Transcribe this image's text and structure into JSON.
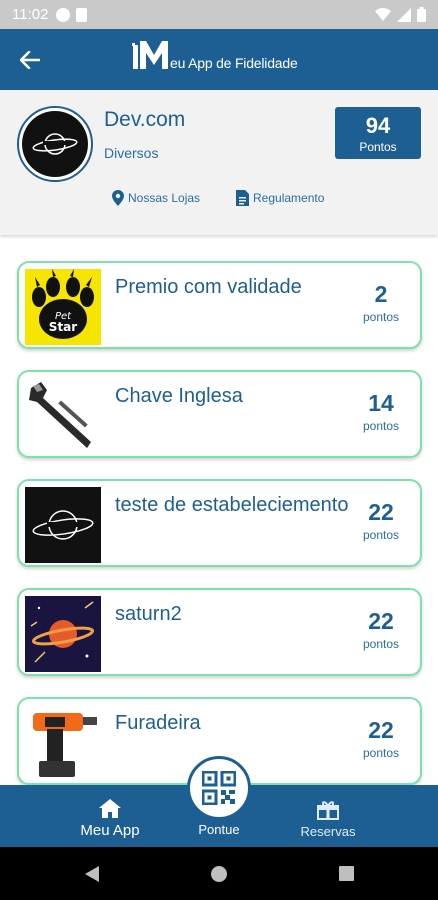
{
  "status_bar": {
    "time": "11:02"
  },
  "app_bar": {
    "logo_text": "eu App de Fidelidade"
  },
  "store": {
    "name": "Dev.com",
    "category": "Diversos",
    "points_value": "94",
    "points_label": "Pontos",
    "links": {
      "stores": "Nossas Lojas",
      "rules": "Regulamento"
    }
  },
  "rewards": [
    {
      "title": "Premio com validade",
      "points": "2",
      "unit": "pontos",
      "image": "pet-star-paw-logo"
    },
    {
      "title": "Chave Inglesa",
      "points": "14",
      "unit": "pontos",
      "image": "wrench"
    },
    {
      "title": "teste de estabeleciemento",
      "points": "22",
      "unit": "pontos",
      "image": "saturn-logo"
    },
    {
      "title": "saturn2",
      "points": "22",
      "unit": "pontos",
      "image": "saturn-space"
    },
    {
      "title": "Furadeira",
      "points": "22",
      "unit": "pontos",
      "image": "drill"
    }
  ],
  "bottom_nav": {
    "home": "Meu App",
    "pontue": "Pontue",
    "reservas": "Reservas"
  },
  "colors": {
    "primary": "#1e5f93",
    "card_border": "#7be3a8",
    "header_bg": "#f2f2f2"
  }
}
